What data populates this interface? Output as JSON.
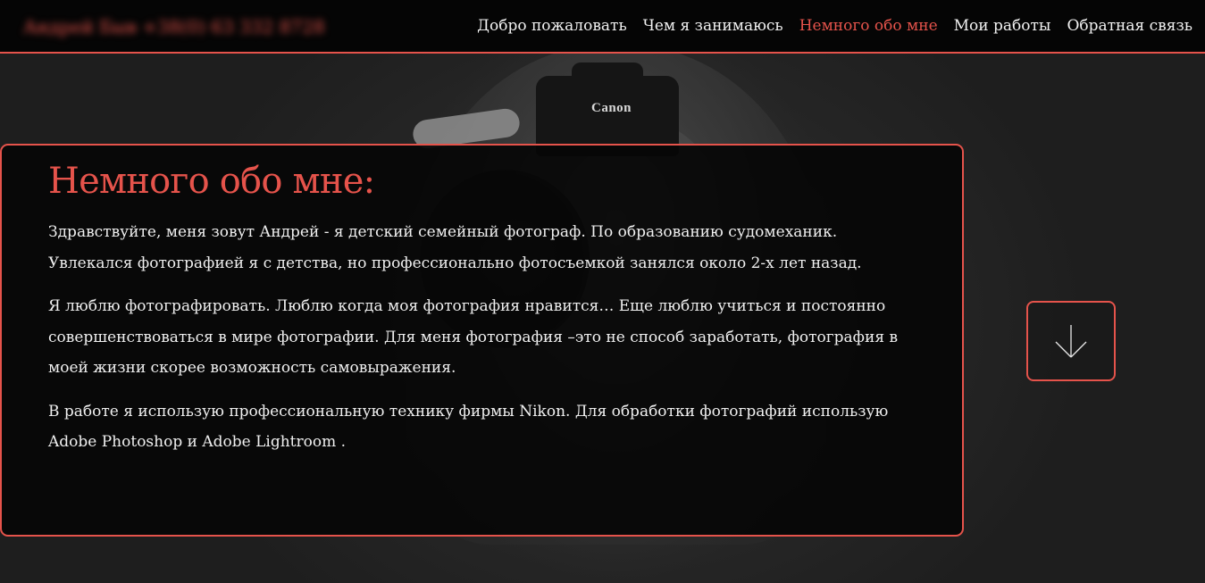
{
  "header": {
    "brand": "Андрей Быв +38(0) 63 332 8728",
    "nav": [
      {
        "label": "Добро пожаловать"
      },
      {
        "label": "Чем я занимаюсь"
      },
      {
        "label": "Немного обо мне",
        "active": true
      },
      {
        "label": "Мои работы"
      },
      {
        "label": "Обратная связь"
      }
    ]
  },
  "background": {
    "camera_brand": "Canon"
  },
  "about": {
    "title": "Немного обо мне:",
    "paragraphs": [
      "Здравствуйте, меня зовут Андрей - я детский семейный фотограф. По образованию судомеханик. Увлекался фотографией я с детства, но профессионально фотосъемкой занялся около 2-х лет назад.",
      "Я люблю фотографировать. Люблю когда моя фотография нравится… Еще люблю учиться и постоянно совершенствоваться в мире фотографии. Для меня фотография –это не способ заработать, фотография в моей жизни скорее возможность самовыражения.",
      "В работе я использую профессиональную технику фирмы Nikon. Для обработки фотографий использую Adobe Photoshop и Adobe Lightroom ."
    ]
  },
  "scroll_button": {
    "icon": "arrow-down-icon"
  },
  "colors": {
    "accent": "#e5534b",
    "header_bg": "#050505",
    "card_bg": "#060606",
    "text": "#f0f0f0"
  }
}
